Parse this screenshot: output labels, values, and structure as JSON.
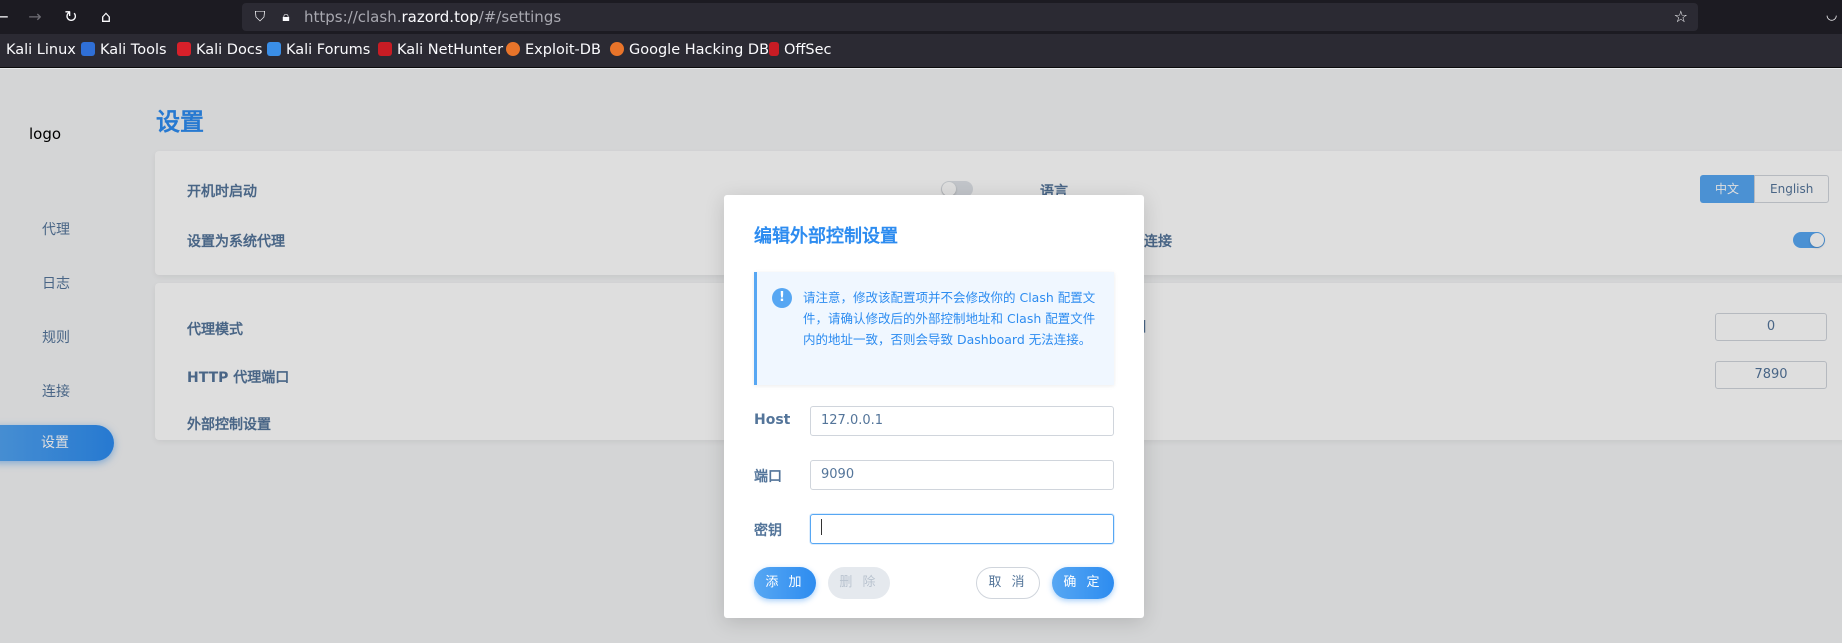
{
  "browser": {
    "url_prefix": "https://clash.",
    "url_host": "razord.top",
    "url_suffix": "/#/settings",
    "bookmarks": [
      "Kali Linux",
      "Kali Tools",
      "Kali Docs",
      "Kali Forums",
      "Kali NetHunter",
      "Exploit-DB",
      "Google Hacking DB",
      "OffSec"
    ]
  },
  "sidebar": {
    "logo": "logo",
    "items": [
      "代理",
      "日志",
      "规则",
      "连接",
      "设置"
    ],
    "active": "设置"
  },
  "page": {
    "title": "设置",
    "card1": {
      "startup_label": "开机时启动",
      "system_proxy_label": "设置为系统代理",
      "language_label": "语言",
      "lang_options": [
        "中文",
        "English"
      ],
      "lang_selected": "中文",
      "right_row2_label": "的连接"
    },
    "card2": {
      "proxy_mode_label": "代理模式",
      "http_port_label": "HTTP 代理端口",
      "external_control_label": "外部控制设置",
      "right_row1_suffix": "]",
      "right_value1": "0",
      "right_value2": "7890"
    }
  },
  "modal": {
    "title": "编辑外部控制设置",
    "alert": "请注意，修改该配置项并不会修改你的 Clash 配置文件，请确认修改后的外部控制地址和 Clash 配置文件内的地址一致，否则会导致 Dashboard 无法连接。",
    "host_label": "Host",
    "host_value": "127.0.0.1",
    "port_label": "端口",
    "port_value": "9090",
    "secret_label": "密钥",
    "secret_value": "",
    "add_label": "添 加",
    "delete_label": "删 除",
    "cancel_label": "取 消",
    "confirm_label": "确 定"
  },
  "colors": {
    "accent": "#2d8cf0",
    "text": "#54759a"
  }
}
